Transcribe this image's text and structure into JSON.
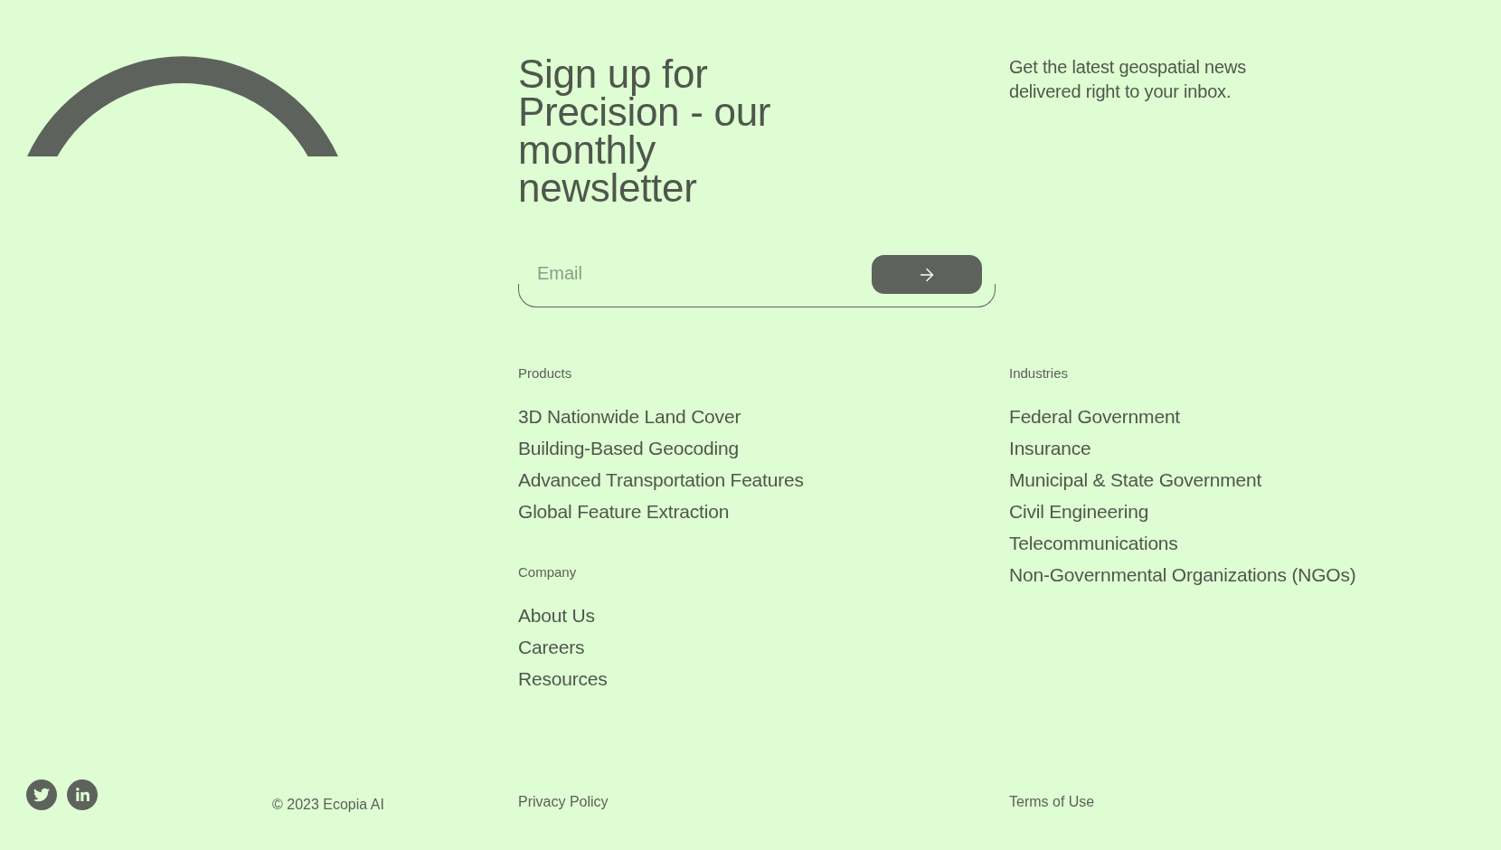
{
  "newsletter": {
    "heading": "Sign up for Precision - our monthly newsletter",
    "email_field": {
      "placeholder": "Email"
    },
    "description": "Get the latest geospatial news delivered right to your inbox."
  },
  "link_columns": [
    {
      "groups": [
        {
          "title": "Products",
          "links": [
            "3D Nationwide Land Cover",
            "Building-Based Geocoding",
            "Advanced Transportation Features",
            "Global Feature Extraction"
          ]
        },
        {
          "title": "Company",
          "links": [
            "About Us",
            "Careers",
            "Resources"
          ]
        }
      ]
    },
    {
      "groups": [
        {
          "title": "Industries",
          "links": [
            "Federal Government",
            "Insurance",
            "Municipal & State Government",
            "Civil Engineering",
            "Telecommunications",
            "Non-Governmental Organizations (NGOs)"
          ]
        }
      ]
    }
  ],
  "footer": {
    "copyright": "© 2023 Ecopia AI",
    "links": [
      "Privacy Policy",
      "Terms of Use"
    ]
  }
}
